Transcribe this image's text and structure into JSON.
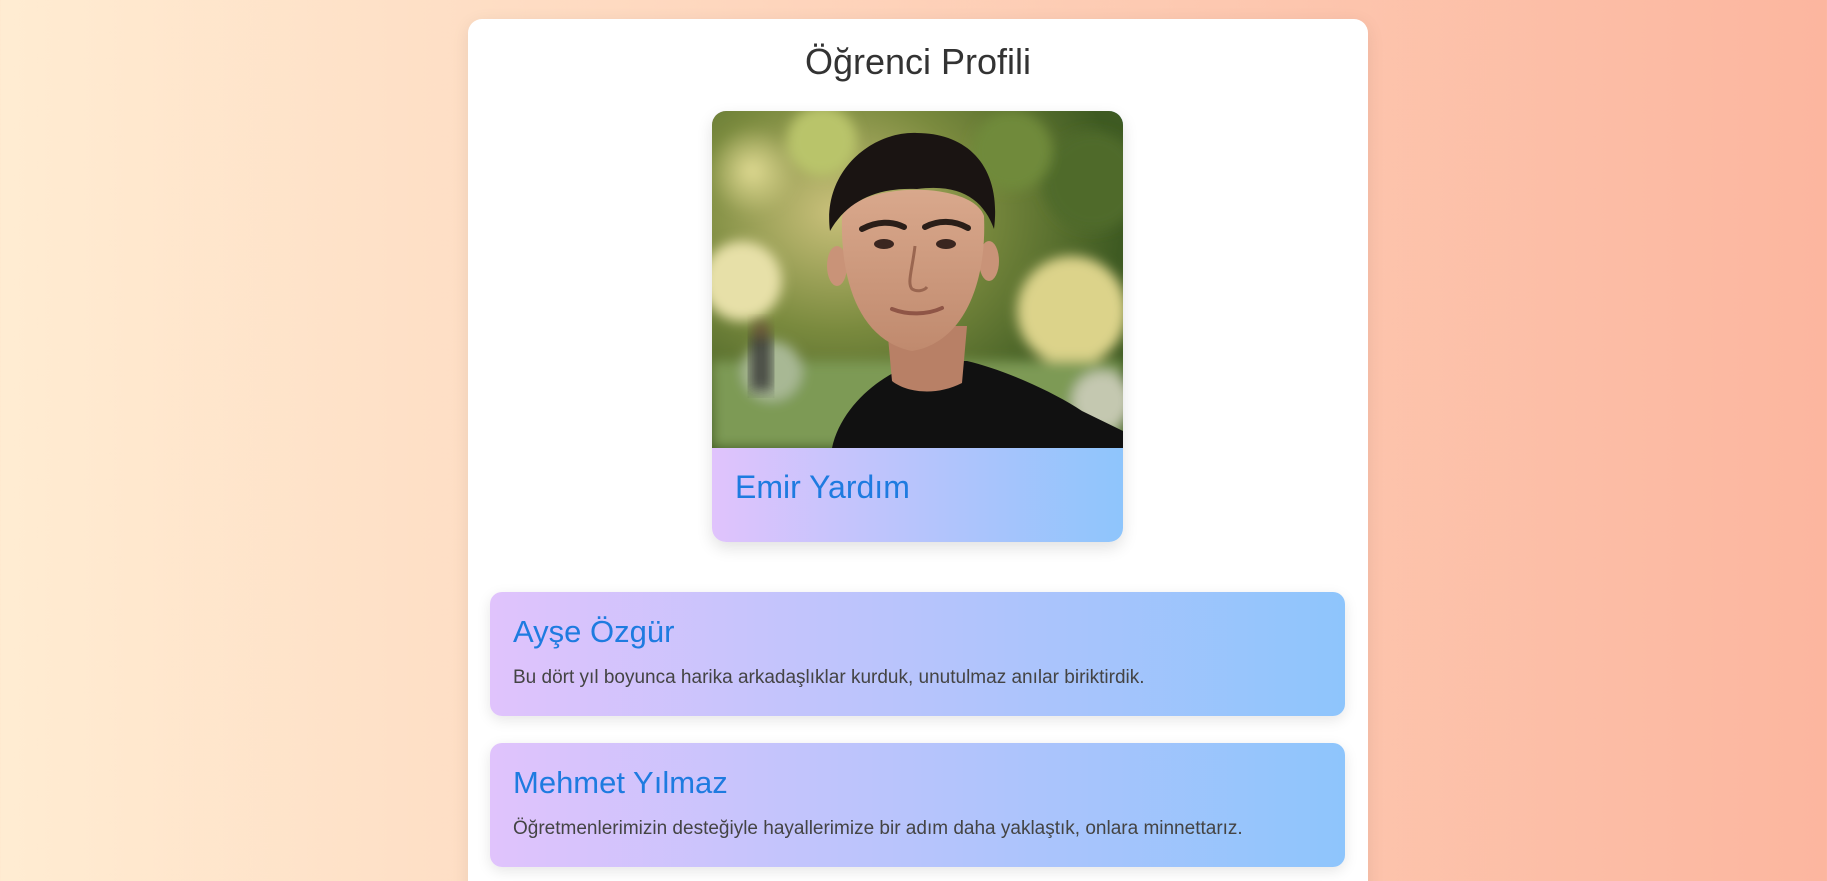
{
  "page": {
    "title": "Öğrenci Profili"
  },
  "profile": {
    "name": "Emir Yardım",
    "photo_alt": "Emir Yardım"
  },
  "messages": [
    {
      "name": "Ayşe Özgür",
      "text": "Bu dört yıl boyunca harika arkadaşlıklar kurduk, unutulmaz anılar biriktirdik."
    },
    {
      "name": "Mehmet Yılmaz",
      "text": "Öğretmenlerimizin desteğiyle hayallerimize bir adım daha yaklaştık, onlara minnettarız."
    }
  ],
  "colors": {
    "background_start": "#ffecd2",
    "background_end": "#fcb69f",
    "card_gradient_start": "#e0c3fc",
    "card_gradient_end": "#8ec5fc",
    "name_color": "#1e7be0",
    "title_color": "#333333"
  }
}
